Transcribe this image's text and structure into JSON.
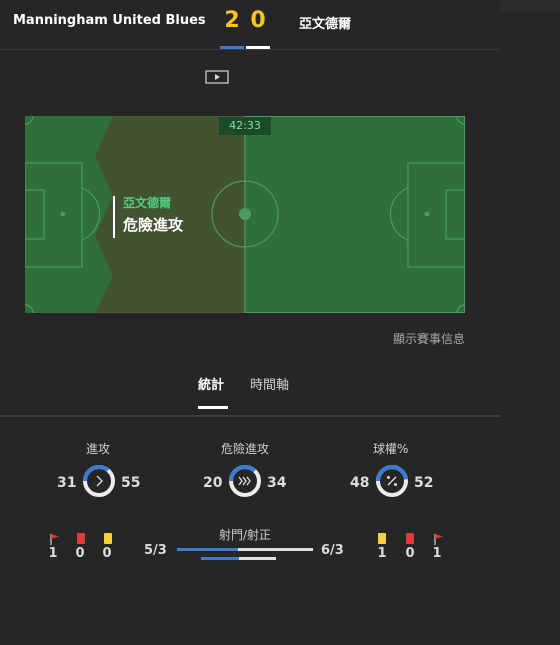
{
  "header": {
    "home_team": "Manningham United Blues",
    "home_score": "2",
    "away_score": "0",
    "away_team": "亞文德爾"
  },
  "view_toggle": {
    "video_icon": "play-video-icon",
    "pitch_icon": "pitch-view-icon",
    "selected": "pitch"
  },
  "pitch": {
    "clock": "42:33",
    "event_team": "亞文德爾",
    "event_action": "危險進攻"
  },
  "show_info_link": "顯示賽事信息",
  "tabs": [
    {
      "label": "統計",
      "active": true
    },
    {
      "label": "時間軸",
      "active": false
    }
  ],
  "stats": {
    "attacks": {
      "title": "進攻",
      "home": "31",
      "away": "55",
      "home_share": 0.36,
      "icon": "chevron-right-icon"
    },
    "dangerous_attacks": {
      "title": "危險進攻",
      "home": "20",
      "away": "34",
      "home_share": 0.37,
      "icon": "triple-chevron-icon"
    },
    "possession": {
      "title": "球權%",
      "home": "48",
      "away": "52",
      "home_share": 0.48,
      "icon": "percent-icon"
    },
    "home_counts": {
      "corners": "1",
      "red_cards": "0",
      "yellow_cards": "0"
    },
    "away_counts": {
      "yellow_cards": "1",
      "red_cards": "0",
      "corners": "1"
    },
    "shots": {
      "title": "射門/射正",
      "home": "5/3",
      "away": "6/3",
      "shots_home_share": 0.45,
      "on_target_home_share": 0.5
    }
  },
  "colors": {
    "home": "#3a7bd5",
    "score": "#f7c71c",
    "pitch": "#2e6b3c",
    "event_team": "#4fd07f",
    "yellow_card": "#f2d13c",
    "red_card": "#e03c3c"
  }
}
